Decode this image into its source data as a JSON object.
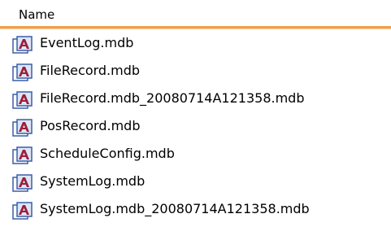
{
  "header": {
    "column_label": "Name",
    "accent_color": "#f0a050"
  },
  "files": [
    {
      "name": "EventLog.mdb",
      "icon": "access-database-icon"
    },
    {
      "name": "FileRecord.mdb",
      "icon": "access-database-icon"
    },
    {
      "name": "FileRecord.mdb_20080714A121358.mdb",
      "icon": "access-database-icon"
    },
    {
      "name": "PosRecord.mdb",
      "icon": "access-database-icon"
    },
    {
      "name": "ScheduleConfig.mdb",
      "icon": "access-database-icon"
    },
    {
      "name": "SystemLog.mdb",
      "icon": "access-database-icon"
    },
    {
      "name": "SystemLog.mdb_20080714A121358.mdb",
      "icon": "access-database-icon"
    }
  ]
}
